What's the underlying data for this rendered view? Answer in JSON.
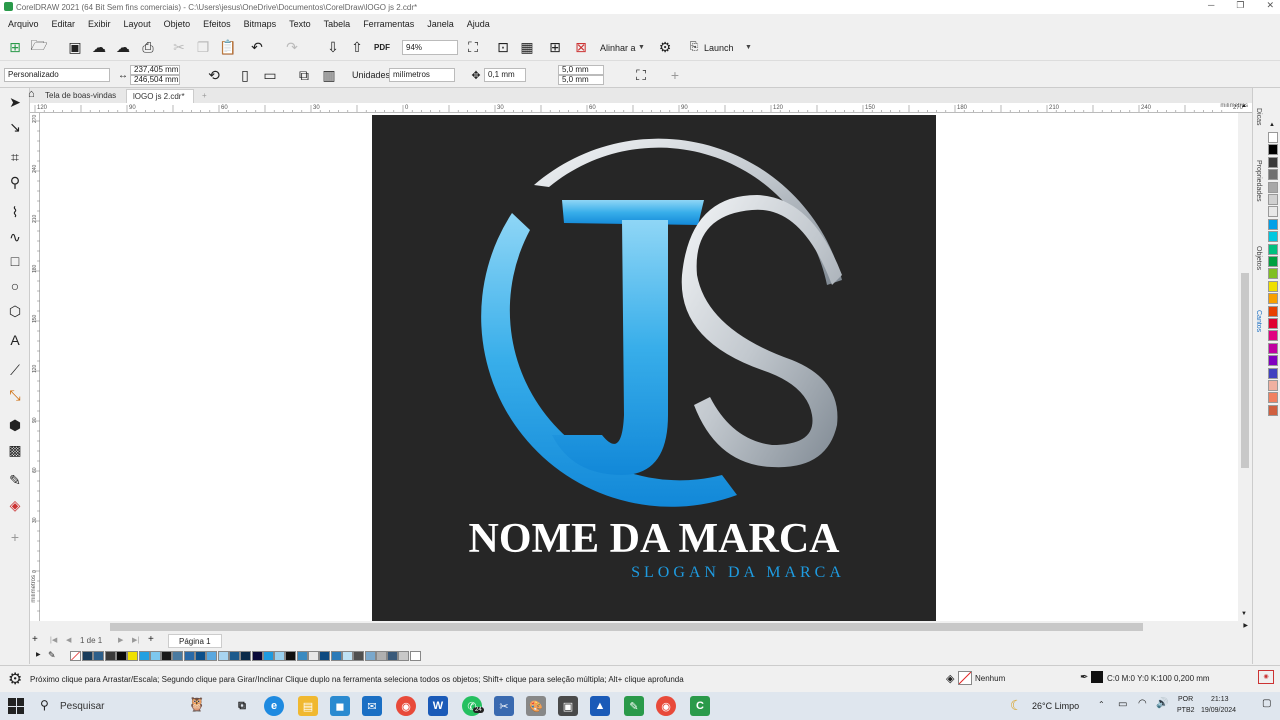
{
  "window": {
    "title": "CorelDRAW 2021 (64 Bit Sem fins comerciais) - C:\\Users\\jesus\\OneDrive\\Documentos\\CorelDraw\\lOGO js 2.cdr*",
    "minimize": "─",
    "maximize": "❐",
    "close": "✕"
  },
  "menu": [
    "Arquivo",
    "Editar",
    "Exibir",
    "Layout",
    "Objeto",
    "Efeitos",
    "Bitmaps",
    "Texto",
    "Tabela",
    "Ferramentas",
    "Janela",
    "Ajuda"
  ],
  "toolbar": {
    "pdf_label": "PDF",
    "zoom": "94%",
    "align_label": "Alinhar a",
    "launch_label": "Launch"
  },
  "propbar": {
    "preset": "Personalizado",
    "width": "237,405 mm",
    "height": "246,504 mm",
    "units_label": "Unidades:",
    "units_value": "milímetros",
    "nudge": "0,1 mm",
    "dup_x": "5,0 mm",
    "dup_y": "5,0 mm"
  },
  "tabs": {
    "welcome": "Tela de boas-vindas",
    "doc": "lOGO js 2.cdr*",
    "add": "+"
  },
  "ruler": {
    "ticks": [
      "120",
      "90",
      "60",
      "30",
      "0",
      "30",
      "60",
      "90",
      "120",
      "150",
      "180",
      "210",
      "240",
      "270"
    ],
    "unit": "milímetros",
    "vticks": [
      "270",
      "240",
      "210",
      "180",
      "150",
      "120",
      "90",
      "60",
      "30",
      "0"
    ],
    "vunit": "milímetros"
  },
  "logo": {
    "brand_name": "NOME DA MARCA",
    "slogan": "SLOGAN DA MARCA",
    "blue": "#1e9be0",
    "silver": "#c9ced4",
    "background": "#262626"
  },
  "pagebar": {
    "page_counter": "1 de 1",
    "page_tab": "Página 1"
  },
  "palette_swatches": [
    "#1a3d5c",
    "#2d5f8a",
    "#3a3a3a",
    "#0a0a0a",
    "#f0e000",
    "#22a0e0",
    "#7ec8ee",
    "#1a1a1a",
    "#4a7aa0",
    "#2a6aa8",
    "#0d4f8a",
    "#5aa8e0",
    "#a8d4f0",
    "#1c5a8c",
    "#0a2a4a",
    "#0a0a3a",
    "#1e9be0",
    "#9ad0ee",
    "#101010",
    "#3a8ac0",
    "#e8e8e8",
    "#0e4a80",
    "#2a7ab8",
    "#bfe2f5",
    "#505050",
    "#7aa8cc",
    "#b0b0b0",
    "#3a5a7a",
    "#c8c8c8",
    "#ffffff"
  ],
  "right_palette": [
    "#ffffff",
    "#000000",
    "#3a3a3a",
    "#707070",
    "#a8a8a8",
    "#d0d0d0",
    "#e8e8e8",
    "#00a0e8",
    "#00c8e0",
    "#00c080",
    "#00a040",
    "#80c020",
    "#f0e000",
    "#f8a000",
    "#e84000",
    "#e00030",
    "#e00080",
    "#c000a0",
    "#8000c0",
    "#4040c0",
    "#f0b0a0",
    "#f08060",
    "#d06040"
  ],
  "dock_labels": [
    "Dicas",
    "Propriedades",
    "Objetos",
    "Cantos"
  ],
  "status": {
    "hint": "Próximo clique para Arrastar/Escala; Segundo clique para Girar/Inclinar Clique duplo na ferramenta seleciona todos os objetos; Shift+ clique para seleção múltipla; Alt+ clique aprofunda",
    "fill": "Nenhum",
    "outline": "C:0 M:0 Y:0 K:100  0,200 mm"
  },
  "taskbar": {
    "search": "Pesquisar",
    "weather": "26°C  Limpo",
    "lang": "POR",
    "lang2": "PTB2",
    "time": "21:13",
    "date": "19/09/2024",
    "badge": "24"
  }
}
